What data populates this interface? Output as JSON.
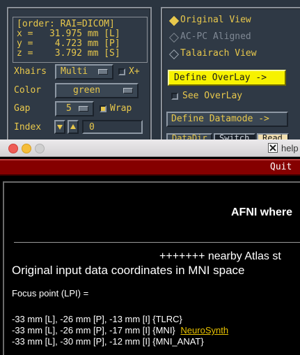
{
  "afni": {
    "coords": {
      "order": "[order: RAI=DICOM]",
      "x": "x =   31.975 mm [L]",
      "y": "y =    4.723 mm [P]",
      "z": "z =    3.792 mm [S]"
    },
    "xhairs": {
      "label": "Xhairs",
      "value": "Multi",
      "x_plus": "X+"
    },
    "color": {
      "label": "Color",
      "value": "green"
    },
    "gap": {
      "label": "Gap",
      "value": "5",
      "wrap": "Wrap"
    },
    "index": {
      "label": "Index",
      "value": "0"
    },
    "views": {
      "original": "Original View",
      "acpc": "AC-PC Aligned",
      "talairach": "Talairach View"
    },
    "define_overlay": "Define OverLay ->",
    "see_overlay": "See OverLay",
    "define_datamode": "Define Datamode ->",
    "bottom_buttons": [
      "DataDir",
      "Switch",
      "Read"
    ]
  },
  "help_window": {
    "title": "help",
    "quit": "Quit",
    "heading": "AFNI where",
    "nearby": "+++++++ nearby Atlas st",
    "original_coords": "Original input data coordinates in MNI space",
    "focus": "Focus point (LPI) =",
    "lines": [
      {
        "text": "-33 mm [L], -26 mm [P], -13 mm [I] {TLRC}",
        "link": ""
      },
      {
        "text": "-33 mm [L], -26 mm [P], -17 mm [I] {MNI}",
        "link": "NeuroSynth"
      },
      {
        "text": "-33 mm [L], -30 mm [P], -12 mm [I] {MNI_ANAT}",
        "link": ""
      }
    ],
    "link_color": "#e8c200"
  }
}
